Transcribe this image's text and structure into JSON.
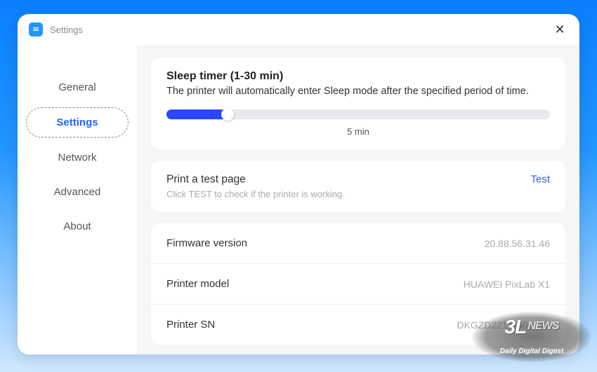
{
  "titlebar": {
    "title": "Settings"
  },
  "sidebar": {
    "items": [
      {
        "label": "General",
        "active": false
      },
      {
        "label": "Settings",
        "active": true
      },
      {
        "label": "Network",
        "active": false
      },
      {
        "label": "Advanced",
        "active": false
      },
      {
        "label": "About",
        "active": false
      }
    ]
  },
  "sleep": {
    "title": "Sleep timer (1-30 min)",
    "desc": "The printer will automatically enter Sleep mode after the specified period of time.",
    "value_label": "5 min",
    "value": 5,
    "min": 1,
    "max": 30
  },
  "testpage": {
    "title": "Print a test page",
    "desc": "Click TEST to check if the printer is working.",
    "action": "Test"
  },
  "info": {
    "rows": [
      {
        "label": "Firmware version",
        "value": "20.88.56.31.46"
      },
      {
        "label": "Printer model",
        "value": "HUAWEI PixLab X1"
      },
      {
        "label": "Printer SN",
        "value": "DKGZD22111500147"
      }
    ]
  },
  "watermark": {
    "brand": "3L",
    "suffix": "NEWS",
    "tagline": "Daily Digital Digest"
  }
}
